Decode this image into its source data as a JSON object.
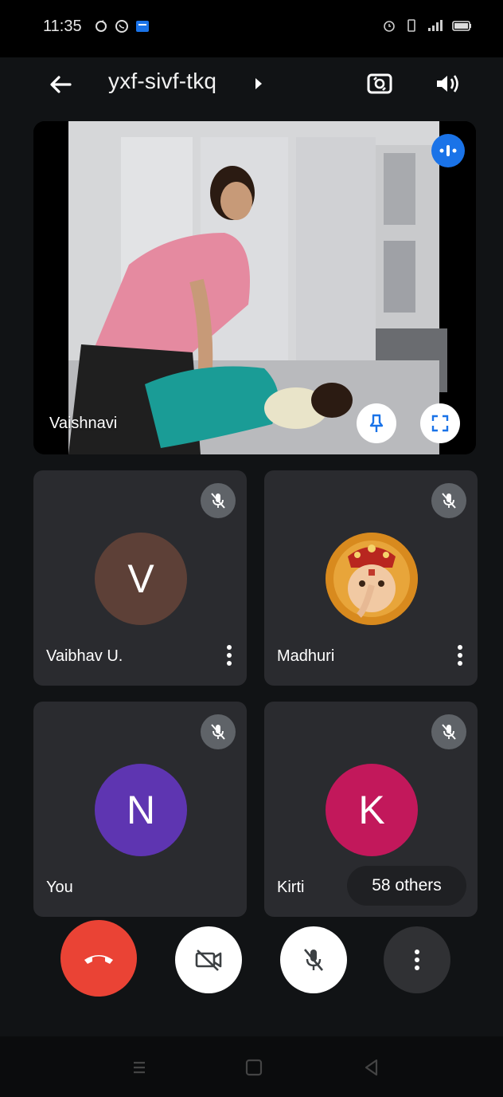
{
  "status_bar": {
    "time": "11:35",
    "icons_left": [
      "sync-icon",
      "whatsapp-icon",
      "message-icon"
    ],
    "icons_right": [
      "alarm-icon",
      "vibrate-icon",
      "signal-icon",
      "battery-icon"
    ]
  },
  "app_bar": {
    "meeting_code": "yxf-sivf-tkq",
    "back_icon": "arrow-back-icon",
    "camera_switch_icon": "camera-switch-icon",
    "speaker_icon": "volume-icon"
  },
  "main_video": {
    "participant_name": "Vaishnavi",
    "speaking": true
  },
  "participants": [
    {
      "name": "Vaibhav U.",
      "initial": "V",
      "avatar_color": "#5d4037",
      "muted": true,
      "has_menu": true
    },
    {
      "name": "Madhuri",
      "initial": "",
      "avatar_type": "image",
      "muted": true,
      "has_menu": true
    },
    {
      "name": "You",
      "initial": "N",
      "avatar_color": "#5e35b1",
      "muted": true,
      "has_menu": false
    },
    {
      "name": "Kirti",
      "initial": "K",
      "avatar_color": "#c2185b",
      "muted": true,
      "has_menu": false
    }
  ],
  "others_label": "58 others",
  "controls": {
    "end_call_icon": "call-end-icon",
    "camera_icon": "videocam-off-icon",
    "mic_icon": "mic-off-icon",
    "more_icon": "more-vert-icon"
  },
  "colors": {
    "accent_blue": "#1a73e8",
    "end_call_red": "#ea4335",
    "tile_bg": "#2a2b2f",
    "app_bg": "#111315"
  },
  "nav": {
    "icons": [
      "recent-apps-icon",
      "home-icon",
      "back-icon"
    ]
  }
}
